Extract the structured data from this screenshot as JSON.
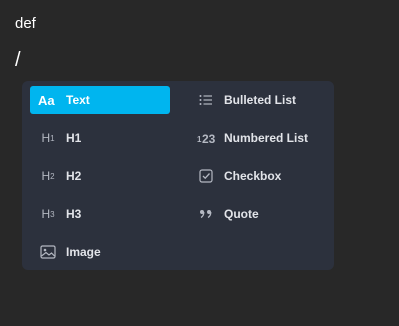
{
  "document": {
    "text": "def",
    "slash": "/"
  },
  "menu": {
    "items": [
      {
        "label": "Text",
        "icon": "text-aa-icon",
        "selected": true
      },
      {
        "label": "H1",
        "icon": "heading-1-icon",
        "icon_text": "H",
        "icon_sub": "1"
      },
      {
        "label": "H2",
        "icon": "heading-2-icon",
        "icon_text": "H",
        "icon_sub": "2"
      },
      {
        "label": "H3",
        "icon": "heading-3-icon",
        "icon_text": "H",
        "icon_sub": "3"
      },
      {
        "label": "Image",
        "icon": "image-icon"
      },
      {
        "label": "Bulleted List",
        "icon": "bulleted-list-icon"
      },
      {
        "label": "Numbered List",
        "icon": "numbered-list-icon"
      },
      {
        "label": "Checkbox",
        "icon": "checkbox-icon"
      },
      {
        "label": "Quote",
        "icon": "quote-icon"
      }
    ]
  },
  "colors": {
    "background": "#282828",
    "menu_bg": "#2c313d",
    "accent": "#00b5ef",
    "text": "#e2e4e9",
    "icon": "#b4b8c2"
  }
}
